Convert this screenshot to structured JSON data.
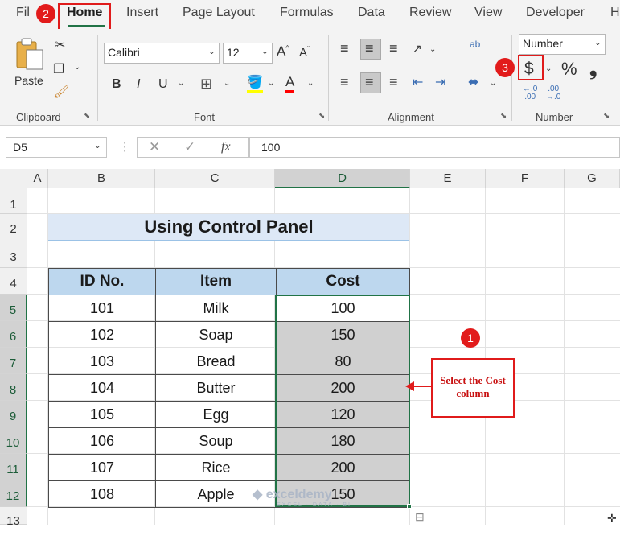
{
  "ribbon_tabs": [
    "File",
    "Home",
    "Insert",
    "Page Layout",
    "Formulas",
    "Data",
    "Review",
    "View",
    "Developer",
    "Help"
  ],
  "ribbon_tabs_visible": [
    "Fil",
    "Home",
    "Insert",
    "Page Layout",
    "Formulas",
    "Data",
    "Review",
    "View",
    "Developer",
    "H"
  ],
  "clipboard": {
    "paste_label": "Paste",
    "group_label": "Clipboard"
  },
  "font": {
    "name": "Calibri",
    "size": "12",
    "group_label": "Font",
    "bold": "B",
    "italic": "I",
    "underline": "U",
    "color_letter": "A"
  },
  "alignment": {
    "group_label": "Alignment",
    "wrap_label": "ab"
  },
  "number": {
    "format": "Number",
    "currency": "$",
    "percent": "%",
    "comma": "❟",
    "inc_decimal": "←.0\n.00",
    "dec_decimal": ".00\n→.0",
    "group_label": "Number"
  },
  "formula_bar": {
    "cell_ref": "D5",
    "fx": "fx",
    "value": "100"
  },
  "columns": [
    "A",
    "B",
    "C",
    "D",
    "E",
    "F",
    "G"
  ],
  "rows": [
    "1",
    "2",
    "3",
    "4",
    "5",
    "6",
    "7",
    "8",
    "9",
    "10",
    "11",
    "12",
    "13"
  ],
  "title": "Using Control Panel",
  "table": {
    "headers": [
      "ID No.",
      "Item",
      "Cost"
    ],
    "rows": [
      [
        "101",
        "Milk",
        "100"
      ],
      [
        "102",
        "Soap",
        "150"
      ],
      [
        "103",
        "Bread",
        "80"
      ],
      [
        "104",
        "Butter",
        "200"
      ],
      [
        "105",
        "Egg",
        "120"
      ],
      [
        "106",
        "Soup",
        "180"
      ],
      [
        "107",
        "Rice",
        "200"
      ],
      [
        "108",
        "Apple",
        "150"
      ]
    ]
  },
  "annotations": {
    "badge_1": "1",
    "badge_2": "2",
    "badge_3": "3",
    "callout": "Select the Cost column",
    "accent_red": "#e01b1b",
    "accent_green": "#217346"
  },
  "watermark": {
    "name": "exceldemy",
    "tagline": "EXCEL · DATA · BI"
  }
}
